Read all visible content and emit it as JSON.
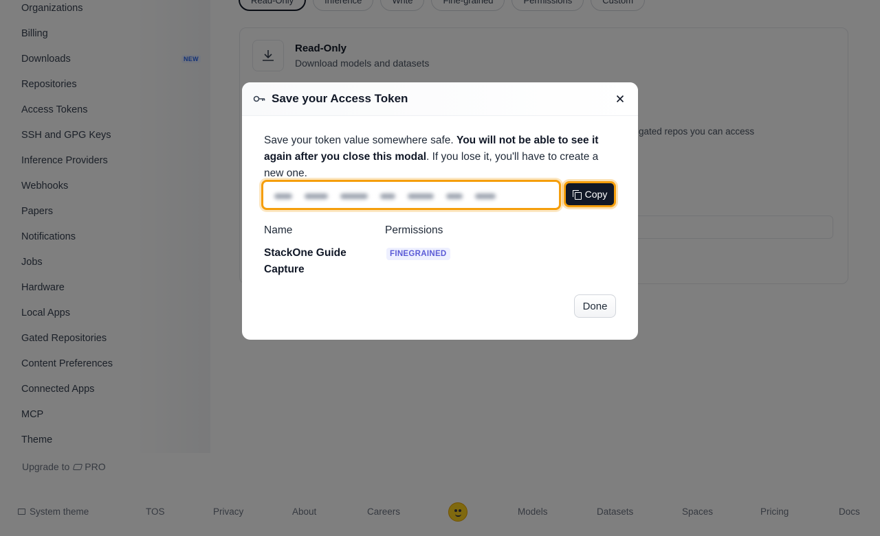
{
  "sidebar": {
    "items": [
      {
        "label": "Organizations"
      },
      {
        "label": "Billing"
      },
      {
        "label": "Downloads"
      },
      {
        "label": "Repositories"
      },
      {
        "label": "Access Tokens"
      },
      {
        "label": "SSH and GPG Keys"
      },
      {
        "label": "Inference Providers"
      },
      {
        "label": "Webhooks"
      },
      {
        "label": "Papers"
      },
      {
        "label": "Notifications"
      },
      {
        "label": "Jobs"
      },
      {
        "label": "Hardware"
      },
      {
        "label": "Local Apps"
      },
      {
        "label": "Gated Repositories"
      },
      {
        "label": "Content Preferences"
      },
      {
        "label": "Connected Apps"
      },
      {
        "label": "MCP"
      },
      {
        "label": "Theme"
      }
    ],
    "new_badge": "NEW",
    "upgrade_text": "Upgrade to",
    "pro_label": "PRO"
  },
  "background": {
    "token_type_tabs": [
      "Read-Only",
      "Inference",
      "Write",
      "Fine-grained",
      "Permissions",
      "Custom"
    ],
    "read_only_title": "Read-Only",
    "read_only_description": "Download models and datasets",
    "gated_text": "gated repos you can access"
  },
  "footer": {
    "theme_label": "System theme",
    "links": [
      "TOS",
      "Privacy",
      "About",
      "Careers",
      "Models",
      "Datasets",
      "Spaces",
      "Pricing",
      "Docs"
    ]
  },
  "modal": {
    "title": "Save your Access Token",
    "message_plain_1": "Save your token value somewhere safe. ",
    "message_bold": "You will not be able to see it again after you close this modal",
    "message_plain_2": ". If you lose it, you'll have to create a new one.",
    "copy_label": "Copy",
    "name_header": "Name",
    "permissions_header": "Permissions",
    "token_name": "StackOne Guide Capture",
    "permission_badge": "FINEGRAINED",
    "done_label": "Done"
  },
  "colors": {
    "accent_highlight": "#f59e0b",
    "copy_button_bg": "#111827",
    "badge_text": "#5b5bd6",
    "badge_bg": "#eef0ff",
    "new_badge": "#2563eb"
  },
  "icons": [
    "key-icon",
    "close-icon",
    "copy-icon",
    "download-icon",
    "monitor-icon",
    "huggingface-logo"
  ]
}
